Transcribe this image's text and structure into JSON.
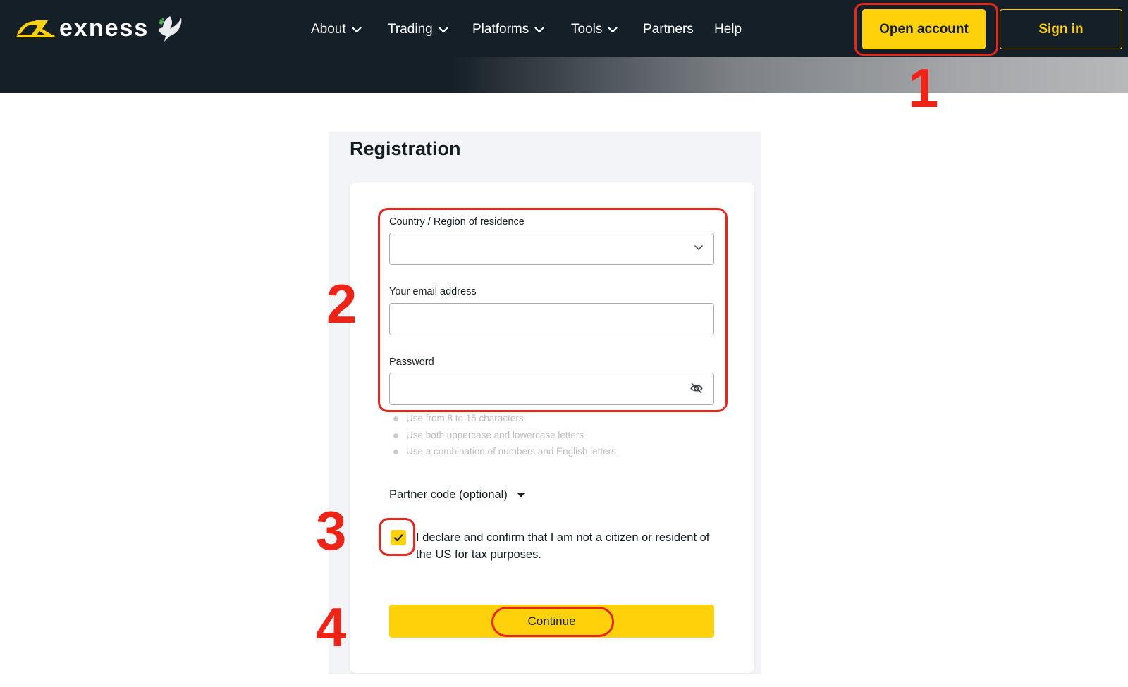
{
  "brand": {
    "name": "exness",
    "accent_color": "#ffd10a",
    "header_bg": "#151f27",
    "icons": [
      "exness-logo-mark-icon",
      "dove-icon"
    ]
  },
  "nav": {
    "items": [
      {
        "label": "About",
        "has_dropdown": true
      },
      {
        "label": "Trading",
        "has_dropdown": true
      },
      {
        "label": "Platforms",
        "has_dropdown": true
      },
      {
        "label": "Tools",
        "has_dropdown": true
      },
      {
        "label": "Partners",
        "has_dropdown": false
      },
      {
        "label": "Help",
        "has_dropdown": false
      }
    ],
    "open_account_label": "Open account",
    "sign_in_label": "Sign in"
  },
  "registration": {
    "title": "Registration",
    "country_label": "Country / Region of residence",
    "country_value": "",
    "email_label": "Your email address",
    "email_value": "",
    "password_label": "Password",
    "password_value": "",
    "password_hints": [
      "Use from 8 to 15 characters",
      "Use both uppercase and lowercase letters",
      "Use a combination of numbers and English letters"
    ],
    "partner_code_label": "Partner code (optional)",
    "declaration_text": "I declare and confirm that I am not a citizen or resident of the US for tax purposes.",
    "declaration_checked": true,
    "continue_label": "Continue"
  },
  "annotations": {
    "color": "#e8261b",
    "steps": [
      "1",
      "2",
      "3",
      "4"
    ]
  }
}
